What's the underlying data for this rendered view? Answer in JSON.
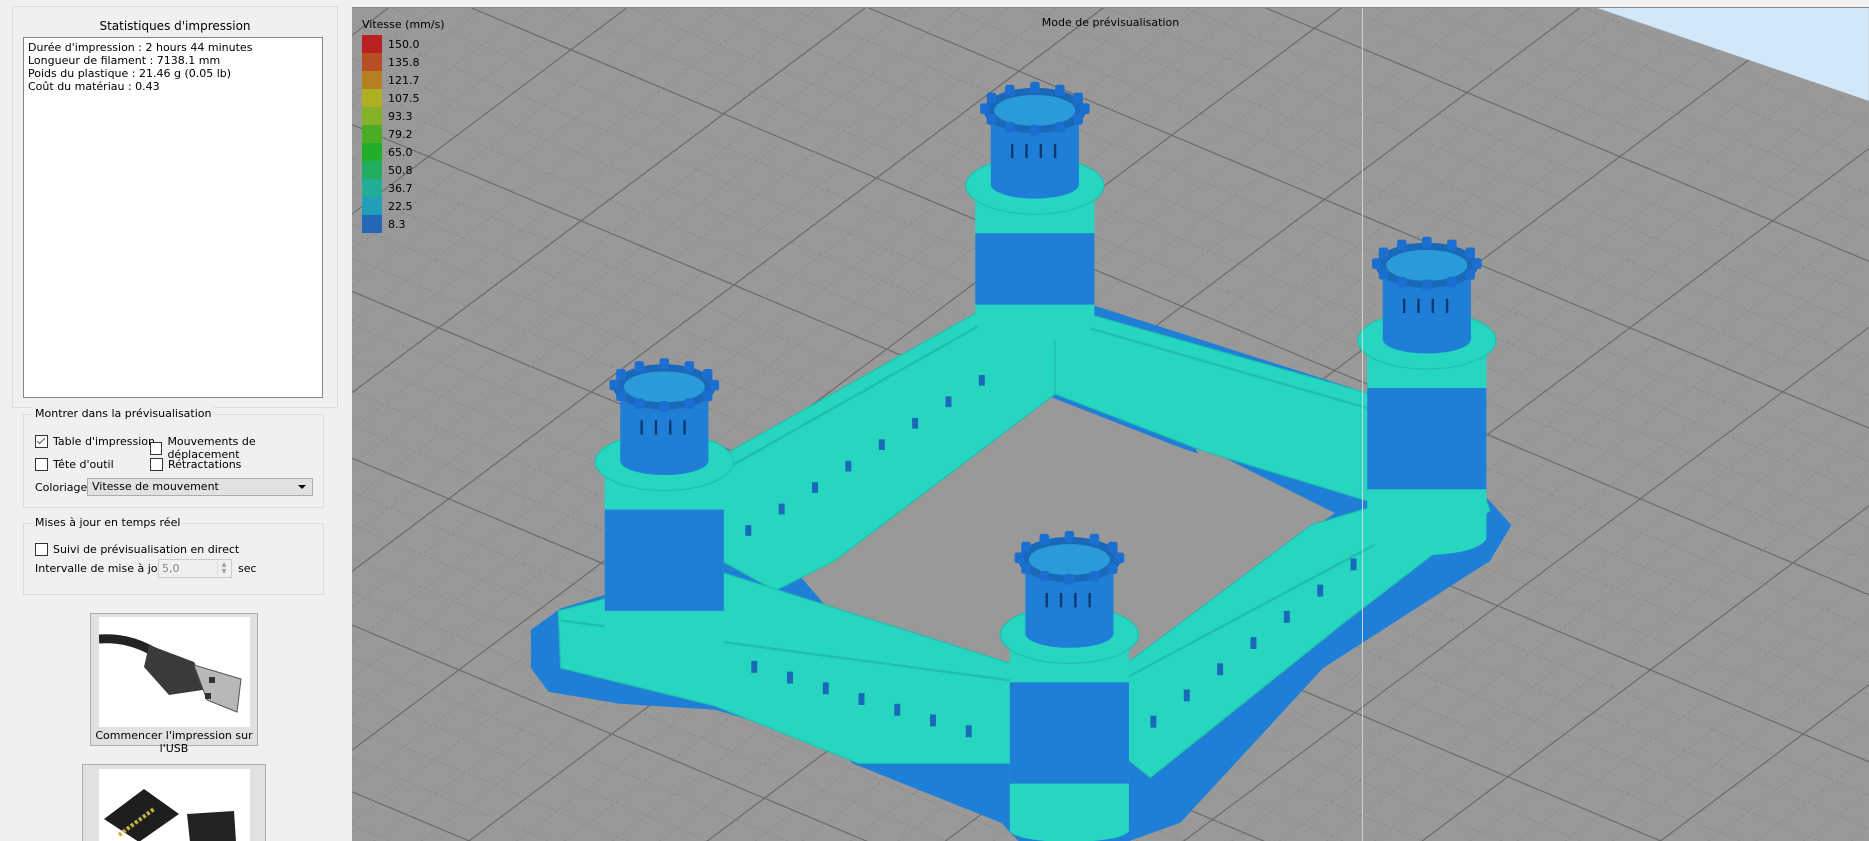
{
  "stats": {
    "title": "Statistiques d'impression",
    "lines": [
      "Durée d'impression : 2 hours 44 minutes",
      "Longueur de filament : 7138.1 mm",
      "Poids du plastique : 21.46 g (0.05 lb)",
      "Coût du matériau : 0.43"
    ]
  },
  "preview_group": {
    "title": "Montrer dans la prévisualisation",
    "print_bed": {
      "label": "Table d'impression",
      "checked": true
    },
    "travel_moves": {
      "label": "Mouvements de déplacement",
      "checked": false
    },
    "tool_head": {
      "label": "Tête d'outil",
      "checked": false
    },
    "retractions": {
      "label": "Rétractations",
      "checked": false
    },
    "coloring_label": "Coloriage",
    "coloring_value": "Vitesse de mouvement"
  },
  "realtime_group": {
    "title": "Mises à jour en temps réel",
    "live_follow": {
      "label": "Suivi de prévisualisation en direct",
      "checked": false
    },
    "interval_label": "Intervalle de mise à jour",
    "interval_value": "5,0",
    "interval_unit": "sec"
  },
  "buttons": {
    "usb_label": "Commencer l'impression sur l'USB"
  },
  "viewport": {
    "title": "Mode de prévisualisation",
    "legend_title": "Vitesse (mm/s)",
    "legend": [
      {
        "value": "150.0",
        "color": "#b8211f"
      },
      {
        "value": "135.8",
        "color": "#b84e24"
      },
      {
        "value": "121.7",
        "color": "#b48122"
      },
      {
        "value": "107.5",
        "color": "#adb021"
      },
      {
        "value": "93.3",
        "color": "#84b128"
      },
      {
        "value": "79.2",
        "color": "#4aad24"
      },
      {
        "value": "65.0",
        "color": "#22ad2a"
      },
      {
        "value": "50.8",
        "color": "#21ad60"
      },
      {
        "value": "36.7",
        "color": "#21ad96"
      },
      {
        "value": "22.5",
        "color": "#229dba"
      },
      {
        "value": "8.3",
        "color": "#2267b8"
      }
    ],
    "colors": {
      "background": "#999999",
      "sky": "#d2e8f8",
      "teal": "#27d6c0",
      "blue": "#1f7fd6"
    }
  }
}
